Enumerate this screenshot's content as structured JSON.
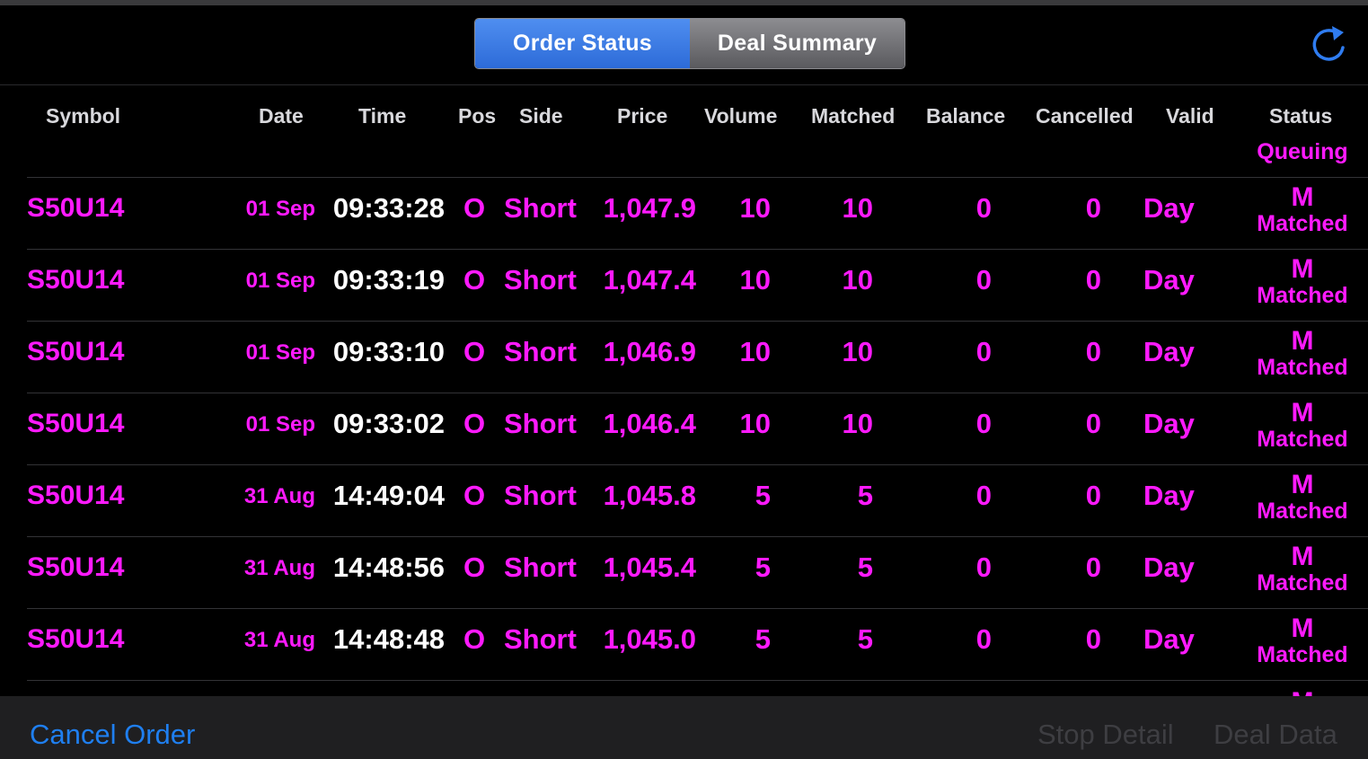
{
  "tabs": [
    {
      "label": "Order Status",
      "active": true
    },
    {
      "label": "Deal Summary",
      "active": false
    }
  ],
  "toolbar": {
    "refresh_icon": "refresh-icon"
  },
  "columns": {
    "symbol": "Symbol",
    "date": "Date",
    "time": "Time",
    "pos": "Pos",
    "side": "Side",
    "price": "Price",
    "volume": "Volume",
    "matched": "Matched",
    "balance": "Balance",
    "cancelled": "Cancelled",
    "valid": "Valid",
    "status": "Status"
  },
  "partial_top_status": "Queuing",
  "rows": [
    {
      "symbol": "S50U14",
      "date": "01 Sep",
      "time": "09:33:28",
      "pos": "O",
      "side": "Short",
      "price": "1,047.9",
      "volume": "10",
      "matched": "10",
      "balance": "0",
      "cancelled": "0",
      "valid": "Day",
      "status_code": "M",
      "status_text": "Matched"
    },
    {
      "symbol": "S50U14",
      "date": "01 Sep",
      "time": "09:33:19",
      "pos": "O",
      "side": "Short",
      "price": "1,047.4",
      "volume": "10",
      "matched": "10",
      "balance": "0",
      "cancelled": "0",
      "valid": "Day",
      "status_code": "M",
      "status_text": "Matched"
    },
    {
      "symbol": "S50U14",
      "date": "01 Sep",
      "time": "09:33:10",
      "pos": "O",
      "side": "Short",
      "price": "1,046.9",
      "volume": "10",
      "matched": "10",
      "balance": "0",
      "cancelled": "0",
      "valid": "Day",
      "status_code": "M",
      "status_text": "Matched"
    },
    {
      "symbol": "S50U14",
      "date": "01 Sep",
      "time": "09:33:02",
      "pos": "O",
      "side": "Short",
      "price": "1,046.4",
      "volume": "10",
      "matched": "10",
      "balance": "0",
      "cancelled": "0",
      "valid": "Day",
      "status_code": "M",
      "status_text": "Matched"
    },
    {
      "symbol": "S50U14",
      "date": "31 Aug",
      "time": "14:49:04",
      "pos": "O",
      "side": "Short",
      "price": "1,045.8",
      "volume": "5",
      "matched": "5",
      "balance": "0",
      "cancelled": "0",
      "valid": "Day",
      "status_code": "M",
      "status_text": "Matched"
    },
    {
      "symbol": "S50U14",
      "date": "31 Aug",
      "time": "14:48:56",
      "pos": "O",
      "side": "Short",
      "price": "1,045.4",
      "volume": "5",
      "matched": "5",
      "balance": "0",
      "cancelled": "0",
      "valid": "Day",
      "status_code": "M",
      "status_text": "Matched"
    },
    {
      "symbol": "S50U14",
      "date": "31 Aug",
      "time": "14:48:48",
      "pos": "O",
      "side": "Short",
      "price": "1,045.0",
      "volume": "5",
      "matched": "5",
      "balance": "0",
      "cancelled": "0",
      "valid": "Day",
      "status_code": "M",
      "status_text": "Matched"
    }
  ],
  "partial_bottom_status": "M",
  "bottom": {
    "cancel_order": "Cancel Order",
    "stop_detail": "Stop Detail",
    "deal_data": "Deal Data"
  },
  "colors": {
    "accent": "#2d6bd8",
    "row_text": "#ff1aff",
    "time_text": "#ffffff",
    "disabled": "#3e3e42",
    "link": "#1f7ff0"
  }
}
